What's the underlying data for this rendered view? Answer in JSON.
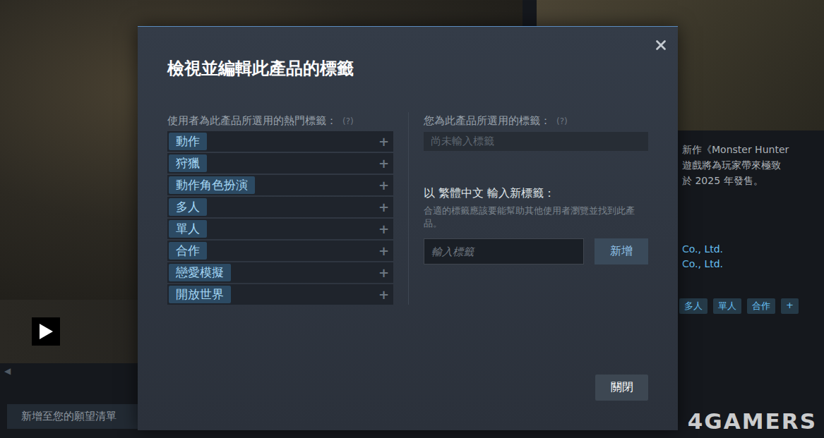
{
  "background": {
    "wishlist_button": "新增至您的願望清單",
    "scroll_arrow": "◀",
    "description": [
      "新作《Monster Hunter",
      "遊戲將為玩家帶來極致",
      "於 2025 年發售。"
    ],
    "companies": [
      "Co., Ltd.",
      "Co., Ltd."
    ],
    "tags": [
      "多人",
      "單人",
      "合作",
      "+"
    ],
    "watermark": "4GAMERS"
  },
  "dialog": {
    "title": "檢視並編輯此產品的標籤",
    "popular_tags": {
      "label": "使用者為此產品所選用的熱門標籤：",
      "hint": "(?)",
      "add_glyph": "+",
      "items": [
        {
          "name": "動作"
        },
        {
          "name": "狩獵"
        },
        {
          "name": "動作角色扮演"
        },
        {
          "name": "多人"
        },
        {
          "name": "單人"
        },
        {
          "name": "合作"
        },
        {
          "name": "戀愛模擬"
        },
        {
          "name": "開放世界"
        }
      ]
    },
    "your_tags": {
      "label": "您為此產品所選用的標籤：",
      "hint": "(?)",
      "empty": "尚未輸入標籤"
    },
    "new_tag": {
      "label": "以 繁體中文 輸入新標籤：",
      "help": "合適的標籤應該要能幫助其他使用者瀏覽並找到此產品。",
      "placeholder": "輸入標籤",
      "button": "新增"
    },
    "close_button": "關閉"
  }
}
